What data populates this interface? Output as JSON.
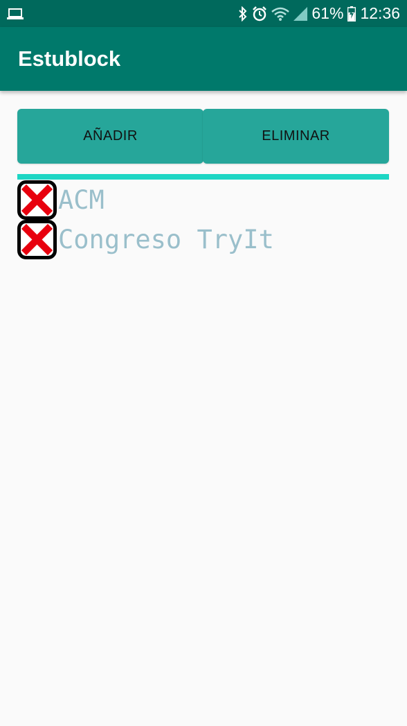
{
  "status_bar": {
    "battery": "61%",
    "time": "12:36",
    "icons": [
      "laptop-icon",
      "bluetooth-icon",
      "alarm-icon",
      "wifi-icon",
      "signal-icon",
      "battery-icon"
    ]
  },
  "app_bar": {
    "title": "Estublock",
    "color": "#00796b"
  },
  "buttons": {
    "add_label": "AÑADIR",
    "delete_label": "ELIMINAR",
    "color": "#26a69a"
  },
  "list": {
    "items": [
      {
        "label": "ACM",
        "icon": "x-close-icon"
      },
      {
        "label": "Congreso TryIt",
        "icon": "x-close-icon"
      }
    ]
  }
}
